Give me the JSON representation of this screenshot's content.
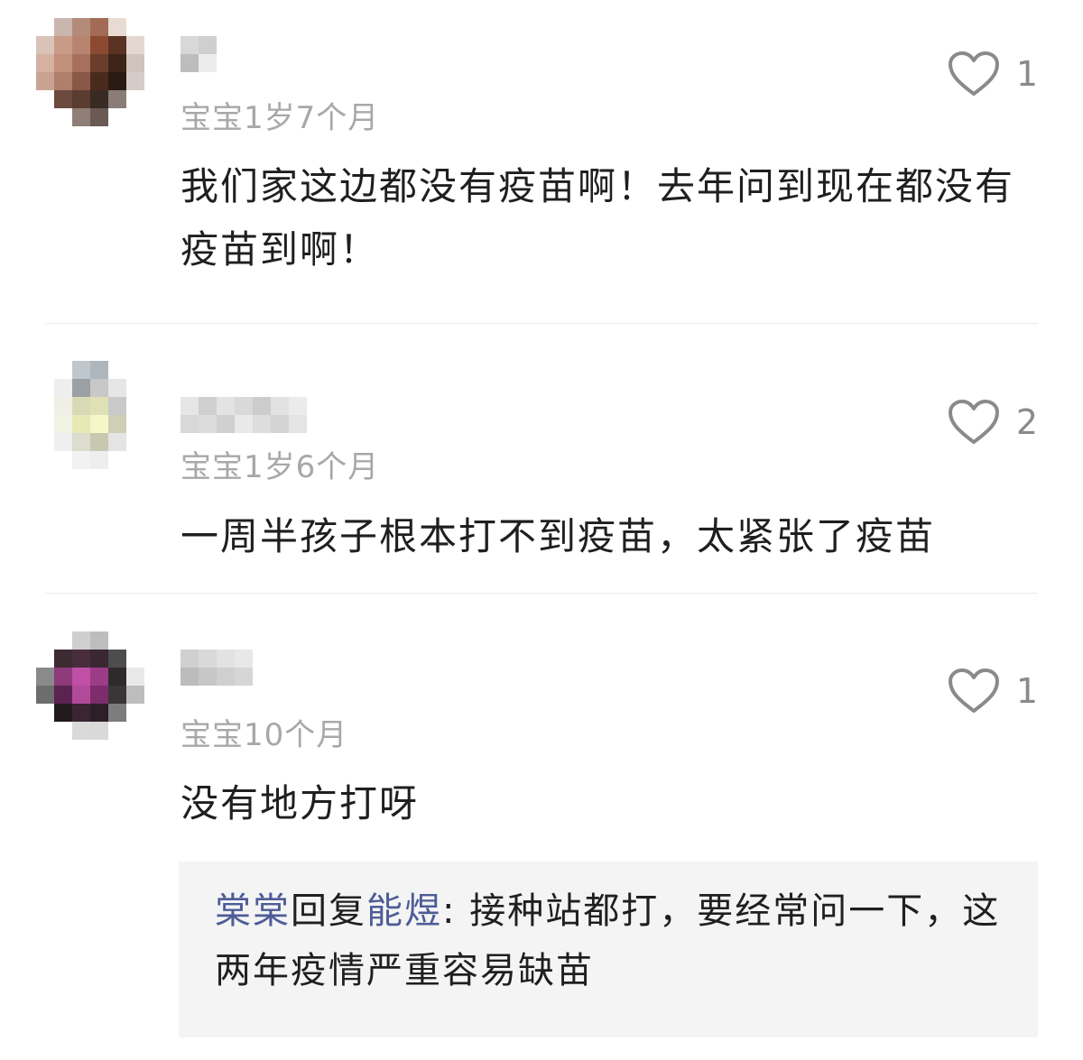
{
  "comments": [
    {
      "baby_age": "宝宝1岁7个月",
      "text": "我们家这边都没有疫苗啊！去年问到现在都没有疫苗到啊！",
      "likes": "1",
      "avatar_palette": [
        "#ffffff",
        "#c9b7ad",
        "#b48a78",
        "#a36b55",
        "#e9dbd4",
        "#ffffff",
        "#d9c2b8",
        "#c79b86",
        "#b88470",
        "#8c4a33",
        "#5a3325",
        "#e4d7d1",
        "#d4b1a0",
        "#c28f7a",
        "#a7705c",
        "#6b3d2b",
        "#3d2418",
        "#cfc3bd",
        "#c9a392",
        "#b07f6b",
        "#8a5846",
        "#4a2a1d",
        "#2b1a12",
        "#d6ccc7",
        "#ffffff",
        "#6d4a3e",
        "#5b3c31",
        "#3a2a24",
        "#8a7d78",
        "#ffffff",
        "#ffffff",
        "#ffffff",
        "#8f7f78",
        "#6a5a53",
        "#ffffff",
        "#ffffff"
      ],
      "name_palette": [
        "#d8d8d8",
        "#bdbdbd",
        "#cfcfcf",
        "#ececec"
      ]
    },
    {
      "baby_age": "宝宝1岁6个月",
      "text": "一周半孩子根本打不到疫苗，太紧张了疫苗",
      "likes": "2",
      "avatar_palette": [
        "#ffffff",
        "#ffffff",
        "#bfc6cc",
        "#aeb6bd",
        "#ffffff",
        "#ffffff",
        "#ffffff",
        "#eeeeee",
        "#9aa0a4",
        "#c8c8c8",
        "#e6e6e6",
        "#ffffff",
        "#ffffff",
        "#efefe6",
        "#d8dab6",
        "#dfe0b5",
        "#c9c9c9",
        "#ffffff",
        "#ffffff",
        "#f3f3e5",
        "#e6e9b5",
        "#f7f6c9",
        "#cfcfb8",
        "#ffffff",
        "#ffffff",
        "#efefef",
        "#dcdccf",
        "#c8c8b0",
        "#e4e4e4",
        "#ffffff",
        "#ffffff",
        "#ffffff",
        "#f2f2f2",
        "#eeeeee",
        "#ffffff",
        "#ffffff"
      ],
      "name_palette": [
        "#e6e6e6",
        "#d8d8d8",
        "#cfcfcf",
        "#dcdcdc",
        "#e3e3e3",
        "#d0d0d0",
        "#d9d9d9",
        "#e9e9e9",
        "#cccccc",
        "#dddddd",
        "#e1e1e1",
        "#d4d4d4",
        "#ebebeb",
        "#e4e4e4"
      ]
    },
    {
      "baby_age": "宝宝10个月",
      "text": "没有地方打呀",
      "likes": "1",
      "avatar_palette": [
        "#ffffff",
        "#ffffff",
        "#cfcfcf",
        "#bdbdbd",
        "#ffffff",
        "#ffffff",
        "#ffffff",
        "#3c2b33",
        "#4a2d3d",
        "#3a2732",
        "#4d4d4d",
        "#ffffff",
        "#8a8a8a",
        "#8d3b7a",
        "#c04fa6",
        "#9c3b86",
        "#2e2a2c",
        "#e9e9e9",
        "#6d6d6d",
        "#5a2350",
        "#b24a9a",
        "#7e2d6c",
        "#3a3537",
        "#bdbdbd",
        "#ffffff",
        "#221a1f",
        "#3b2434",
        "#2d1f28",
        "#7d7d7d",
        "#ffffff",
        "#ffffff",
        "#ffffff",
        "#dadada",
        "#d9d9d9",
        "#ffffff",
        "#ffffff"
      ],
      "name_palette": [
        "#d0d0d0",
        "#bcbcbc",
        "#d9d9d9",
        "#c7c7c7",
        "#e2e2e2",
        "#cfcfcf",
        "#e8e8e8",
        "#d6d6d6"
      ],
      "reply": {
        "from": "棠棠",
        "verb": "回复",
        "to": "能煜",
        "sep": ": ",
        "text": "接种站都打，要经常问一下，这两年疫情严重容易缺苗"
      }
    }
  ],
  "colors": {
    "reply_name": "#4e5c96",
    "meta": "#a8a8a8",
    "like_icon": "#8a8a8a"
  },
  "icons": {
    "like": "heart-outline-icon"
  }
}
